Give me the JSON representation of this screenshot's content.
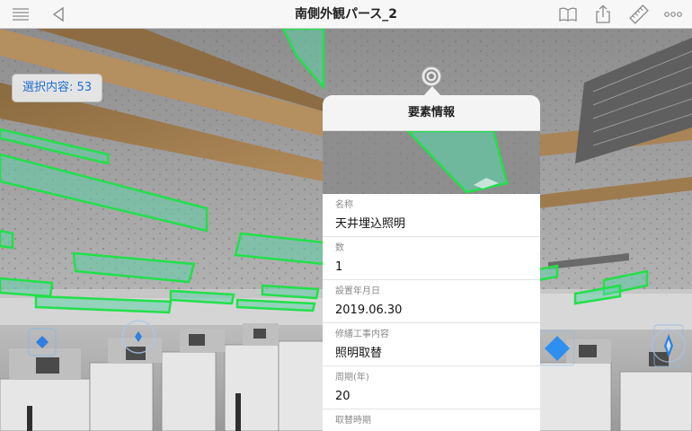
{
  "header": {
    "title": "南側外観パース_2",
    "menu_icon": "list-icon",
    "back_icon": "back-triangle-icon",
    "book_icon": "book-icon",
    "share_icon": "share-icon",
    "measure_icon": "ruler-icon",
    "more_icon": "more-dots-icon"
  },
  "selection_badge": "選択内容: 53",
  "popup": {
    "title": "要素情報",
    "properties": [
      {
        "label": "名称",
        "value": "天井埋込照明"
      },
      {
        "label": "数",
        "value": "1"
      },
      {
        "label": "設置年月日",
        "value": "2019.06.30"
      },
      {
        "label": "修繕工事内容",
        "value": "照明取替"
      },
      {
        "label": "周期(年)",
        "value": "20"
      },
      {
        "label": "取替時期",
        "value": ""
      }
    ]
  },
  "colors": {
    "selection_outline": "#22e04a",
    "selection_fill": "#5fd0a8",
    "accent_blue": "#1f6fd1",
    "ceiling": "#9e9e9e",
    "beam": "#9c7a4e"
  }
}
